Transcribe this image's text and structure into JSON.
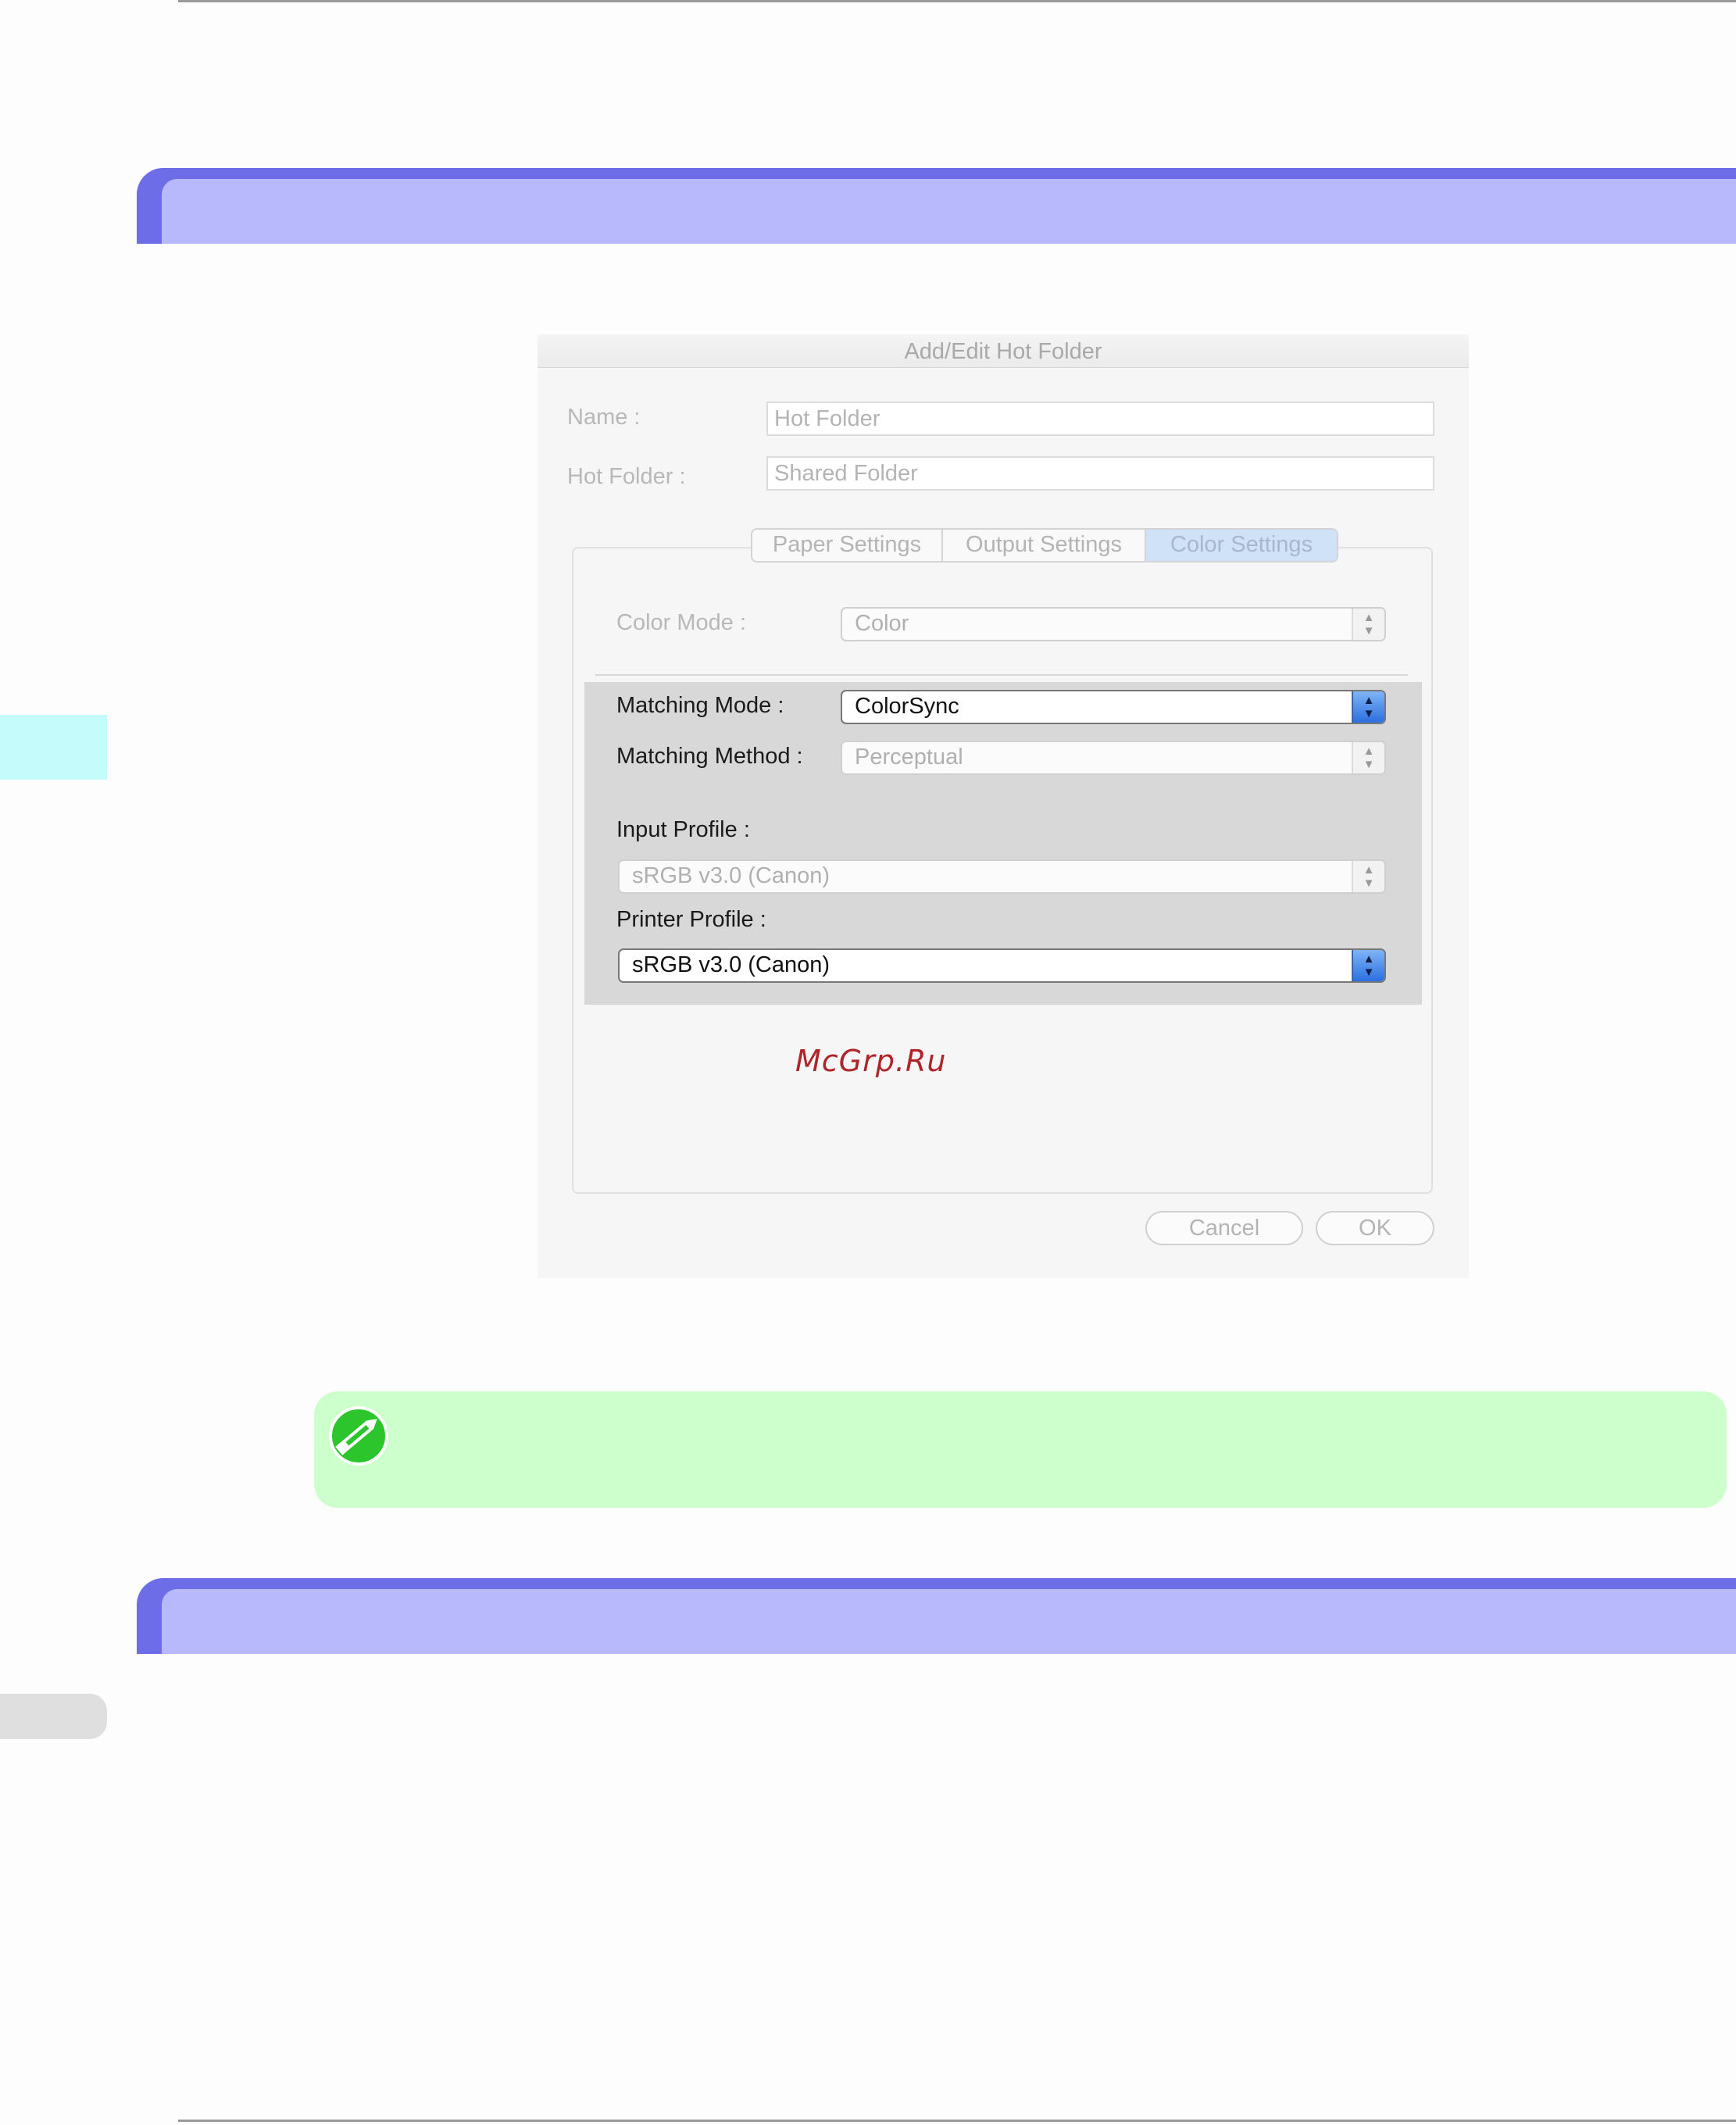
{
  "dialog": {
    "title": "Add/Edit Hot Folder",
    "name_label": "Name :",
    "name_value": "Hot Folder",
    "hot_folder_label": "Hot Folder :",
    "hot_folder_value": "Shared Folder",
    "tabs": [
      "Paper Settings",
      "Output Settings",
      "Color Settings"
    ],
    "active_tab": "Color Settings",
    "color_mode_label": "Color Mode :",
    "color_mode_value": "Color",
    "matching_mode_label": "Matching Mode :",
    "matching_mode_value": "ColorSync",
    "matching_method_label": "Matching Method :",
    "matching_method_value": "Perceptual",
    "input_profile_label": "Input Profile :",
    "input_profile_value": "sRGB v3.0 (Canon)",
    "printer_profile_label": "Printer Profile :",
    "printer_profile_value": "sRGB v3.0 (Canon)",
    "cancel_label": "Cancel",
    "ok_label": "OK"
  },
  "watermark": "McGrp.Ru",
  "icons": {
    "note": "pencil-note-icon",
    "select_arrows": "up-down-arrows-icon"
  },
  "colors": {
    "section_bar": "#6d6de8",
    "section_bar_inner": "#b8b8fc",
    "note_bg": "#ccffcc",
    "side_tab": "#c6fbfb",
    "watermark": "#b0252a"
  }
}
